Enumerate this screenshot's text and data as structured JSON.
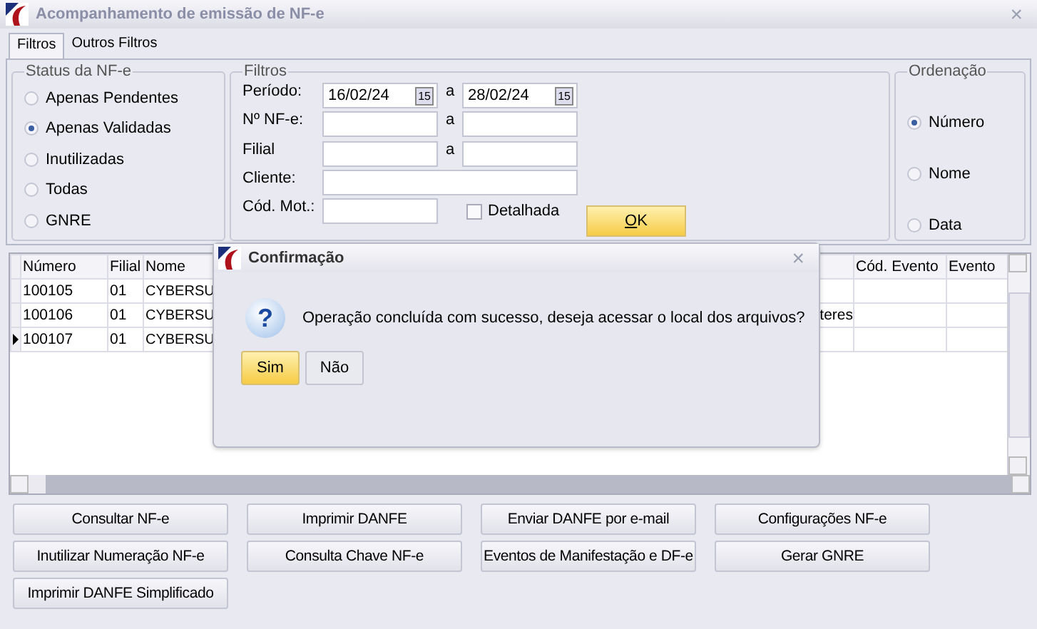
{
  "window": {
    "title": "Acompanhamento de emissão de NF-e",
    "close": "×"
  },
  "tabs": [
    {
      "label": "Filtros",
      "selected": true
    },
    {
      "label": "Outros Filtros",
      "selected": false
    }
  ],
  "status_group": {
    "title": "Status da NF-e",
    "options": [
      {
        "label": "Apenas Pendentes",
        "selected": false
      },
      {
        "label": "Apenas Validadas",
        "selected": true
      },
      {
        "label": "Inutilizadas",
        "selected": false
      },
      {
        "label": "Todas",
        "selected": false
      },
      {
        "label": "GNRE",
        "selected": false
      }
    ]
  },
  "filters": {
    "title": "Filtros",
    "periodo": {
      "label": "Período:",
      "from": "16/02/24",
      "to": "28/02/24",
      "sep": "a",
      "calendar_from": "15",
      "calendar_to": "15"
    },
    "nfe": {
      "label": "Nº NF-e:",
      "sep": "a"
    },
    "filial": {
      "label": "Filial",
      "sep": "a"
    },
    "cliente": {
      "label": "Cliente:"
    },
    "cod_mot": {
      "label": "Cód. Mot.:"
    },
    "detalhada": {
      "label": "Detalhada",
      "checked": false
    },
    "ok": "OK"
  },
  "ordering": {
    "title": "Ordenação",
    "options": [
      {
        "label": "Número",
        "selected": true
      },
      {
        "label": "Nome",
        "selected": false
      },
      {
        "label": "Data",
        "selected": false
      }
    ]
  },
  "table": {
    "columns": [
      "Número",
      "Filial",
      "Nome",
      "",
      "Cód. Evento",
      "Evento"
    ],
    "rows": [
      {
        "cells": [
          "100105",
          "01",
          "CYBERSU",
          "",
          "",
          ""
        ],
        "current": false
      },
      {
        "cells": [
          "100106",
          "01",
          "CYBERSU",
          "teres",
          "",
          ""
        ],
        "current": false
      },
      {
        "cells": [
          "100107",
          "01",
          "CYBERSU",
          "",
          "",
          ""
        ],
        "current": true
      }
    ]
  },
  "buttons": [
    [
      "Consultar NF-e",
      "Imprimir DANFE",
      "Enviar DANFE por e-mail",
      "Configurações NF-e"
    ],
    [
      "Inutilizar Numeração NF-e",
      "Consulta Chave NF-e",
      "Eventos de Manifestação e DF-e",
      "Gerar GNRE"
    ],
    [
      "Imprimir DANFE Simplificado"
    ]
  ],
  "dialog": {
    "title": "Confirmação",
    "close": "×",
    "message": "Operação concluída com sucesso, deseja acessar o local dos arquivos?",
    "icon": "?",
    "buttons": [
      {
        "label": "Sim",
        "focused": true
      },
      {
        "label": "Não",
        "focused": false
      }
    ]
  }
}
